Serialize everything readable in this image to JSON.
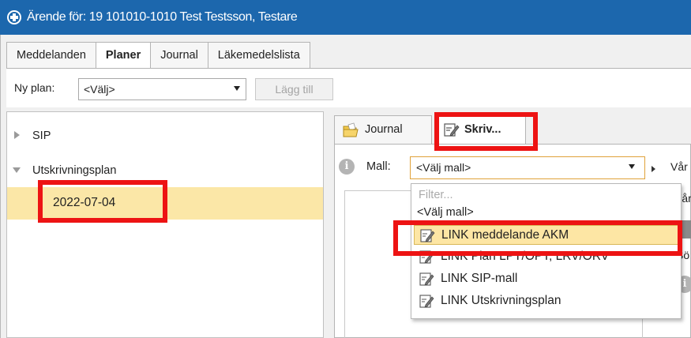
{
  "window": {
    "title": "Ärende för: 19 101010-1010 Test Testsson, Testare"
  },
  "tabs": [
    {
      "label": "Meddelanden"
    },
    {
      "label": "Planer"
    },
    {
      "label": "Journal"
    },
    {
      "label": "Läkemedelslista"
    }
  ],
  "active_tab": "Planer",
  "toolbar": {
    "ny_plan_label": "Ny plan:",
    "ny_plan_value": "<Välj>",
    "add_button": "Lägg till"
  },
  "tree": {
    "items": [
      {
        "label": "SIP",
        "expanded": false
      },
      {
        "label": "Utskrivningsplan",
        "expanded": true
      }
    ],
    "selected_child": "2022-07-04"
  },
  "right_tabs": [
    {
      "label": "Journal",
      "icon": "folder-icon"
    },
    {
      "label": "Skriv...",
      "icon": "edit-document-icon"
    }
  ],
  "active_right_tab": "Skriv...",
  "template": {
    "info_glyph": "i",
    "label": "Mall:",
    "value": "<Välj mall>"
  },
  "side_texts": [
    "Vår",
    "Vår",
    "Sö"
  ],
  "dropdown": {
    "filter_placeholder": "Filter...",
    "partial_option": "<Välj mall>",
    "options": [
      {
        "label": "LINK meddelande AKM",
        "highlighted": true
      },
      {
        "label": "LINK Plan LPT/OPT, LRV/ORV",
        "highlighted": false
      },
      {
        "label": "LINK SIP-mall",
        "highlighted": false
      },
      {
        "label": "LINK Utskrivningsplan",
        "highlighted": false
      }
    ]
  },
  "colors": {
    "titlebar": "#1c67ad",
    "selection": "#fbe7a7",
    "highlight_border": "#ed1313"
  }
}
